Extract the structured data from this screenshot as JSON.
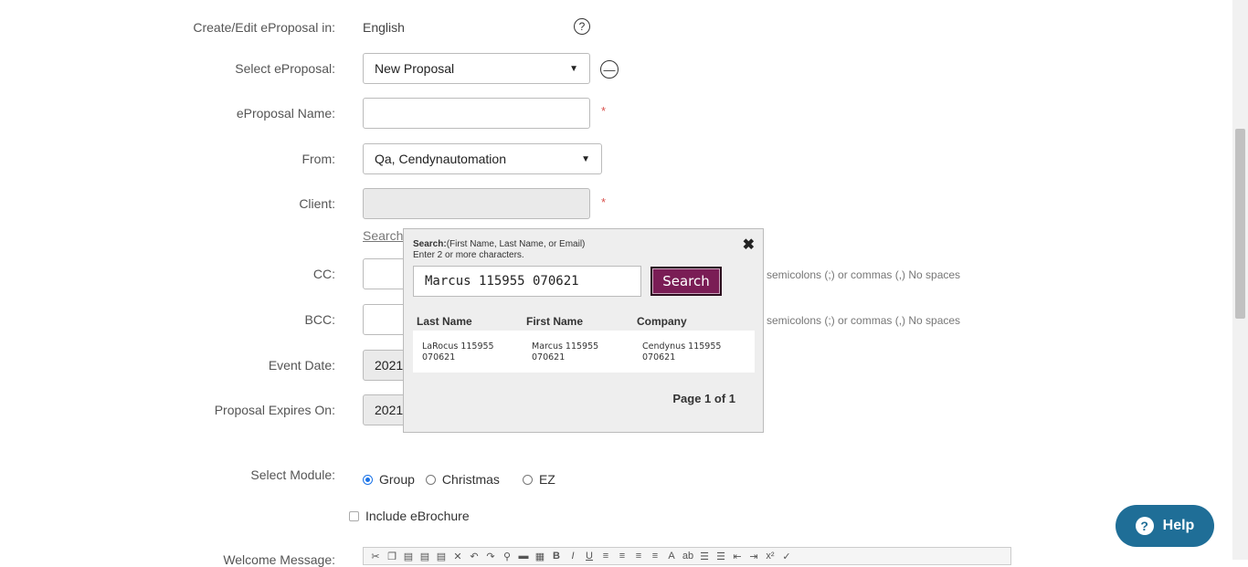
{
  "form": {
    "language": {
      "label": "Create/Edit eProposal in:",
      "value": "English"
    },
    "select_eproposal": {
      "label": "Select eProposal:",
      "value": "New Proposal"
    },
    "eproposal_name": {
      "label": "eProposal Name:",
      "value": "",
      "required_mark": "*"
    },
    "from": {
      "label": "From:",
      "value": "Qa, Cendynautomation"
    },
    "client": {
      "label": "Client:",
      "value": "",
      "required_mark": "*",
      "search_link": "Search"
    },
    "cc": {
      "label": "CC:",
      "hint": "Separate multiple emails with semicolons (;) or commas (,) No spaces",
      "hint_visible": "n semicolons (;) or commas (,) No spaces"
    },
    "bcc": {
      "label": "BCC:",
      "hint_visible": "n semicolons (;) or commas (,) No spaces"
    },
    "event_date": {
      "label": "Event Date:",
      "value": "2021"
    },
    "expires_on": {
      "label": "Proposal Expires On:",
      "value": "2021"
    },
    "select_module": {
      "label": "Select Module:",
      "options": [
        {
          "label": "Group",
          "checked": true
        },
        {
          "label": "Christmas",
          "checked": false
        },
        {
          "label": "EZ",
          "checked": false
        }
      ]
    },
    "include_ebrochure": {
      "label": "Include eBrochure",
      "checked": false
    },
    "welcome_message": {
      "label": "Welcome Message:"
    }
  },
  "search_popup": {
    "title": "Search:",
    "title_hint": "(First Name, Last Name, or Email)",
    "subhint": "Enter 2 or more characters.",
    "query": "Marcus 115955 070621",
    "button": "Search",
    "close_icon": "close-icon",
    "columns": [
      "Last Name",
      "First Name",
      "Company"
    ],
    "results": [
      {
        "last_name": "LaRocus 115955 070621",
        "first_name": "Marcus 115955 070621",
        "company": "Cendynus 115955 070621"
      }
    ],
    "pager": "Page 1 of 1"
  },
  "help_button": {
    "label": "Help",
    "icon": "question-circle-icon"
  },
  "colors": {
    "search_button": "#7a1d55",
    "help": "#1f6e97",
    "required": "#d9534f",
    "radio_checked": "#1a73e8"
  }
}
